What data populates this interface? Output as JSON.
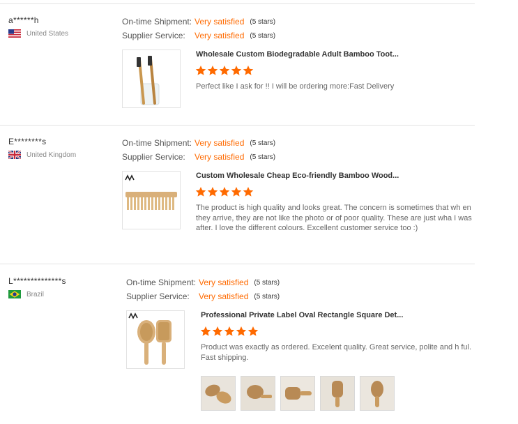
{
  "labels": {
    "shipment": "On-time Shipment:",
    "service": "Supplier Service:",
    "satisfied": "Very satisfied",
    "stars": "(5 stars)"
  },
  "colors": {
    "accent": "#ff6a00",
    "divider": "#e3e3e3",
    "muted": "#888888"
  },
  "reviews": [
    {
      "buyer": "a******h",
      "country": "United States",
      "flag_icon": "us-flag-icon",
      "shipment_value": "Very satisfied",
      "shipment_stars": "(5 stars)",
      "service_value": "Very satisfied",
      "service_stars": "(5 stars)",
      "product_title": "Wholesale Custom Biodegradable Adult Bamboo Toot...",
      "rating": 5,
      "text": "Perfect like I ask for  !! I will be ordering more:Fast Delivery"
    },
    {
      "buyer": "E********s",
      "country": "United Kingdom",
      "flag_icon": "uk-flag-icon",
      "shipment_value": "Very satisfied",
      "shipment_stars": "(5 stars)",
      "service_value": "Very satisfied",
      "service_stars": "(5 stars)",
      "product_title": "Custom Wholesale Cheap Eco-friendly Bamboo Wood...",
      "rating": 5,
      "text": "The product is high quality and looks great. The concern is sometimes that wh en they arrive, they are not like the photo or of poor quality. These are just wha I was after. I love the different colours. Excellent customer service too :)"
    },
    {
      "buyer": "L**************s",
      "country": "Brazil",
      "flag_icon": "brazil-flag-icon",
      "shipment_value": "Very satisfied",
      "shipment_stars": "(5 stars)",
      "service_value": "Very satisfied",
      "service_stars": "(5 stars)",
      "product_title": "Professional Private Label Oval Rectangle Square Det...",
      "rating": 5,
      "text": "Product was exactly as ordered. Excelent quality. Great service, polite and h ful. Fast shipping.",
      "photo_count": 5
    }
  ]
}
